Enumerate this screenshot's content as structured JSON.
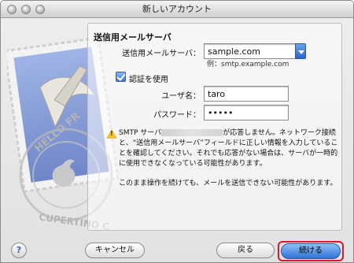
{
  "window": {
    "title": "新しいアカウント"
  },
  "section": {
    "title": "送信用メールサーバ"
  },
  "form": {
    "server_label": "送信用メールサーバ：",
    "server_value": "sample.com",
    "server_example": "例：smtp.example.com",
    "auth_checkbox_label": "認証を使用",
    "auth_checked": true,
    "username_label": "ユーザ名：",
    "username_value": "taro",
    "password_label": "パスワード：",
    "password_value": "•••••"
  },
  "warning": {
    "text_before": "SMTP サーバ",
    "text_after": "が応答しません。ネットワーク接続と、“送信用メールサーバ”フィールドに正しい情報を入力していることを確認してください。それでも応答がない場合は、サーバが一時的に使用できなくなっている可能性があります。",
    "text_continue": "このまま操作を続けても、メールを送信できない可能性があります。"
  },
  "buttons": {
    "help": "?",
    "cancel": "キャンセル",
    "back": "戻る",
    "continue": "続ける"
  },
  "stamp": {
    "text_top": "HELLO FR",
    "text_bottom": "CUPERTINO C"
  },
  "colors": {
    "accent_button": "#2f73d6",
    "highlight_outline": "#e0152b",
    "warning_icon": "#f2c12e"
  }
}
